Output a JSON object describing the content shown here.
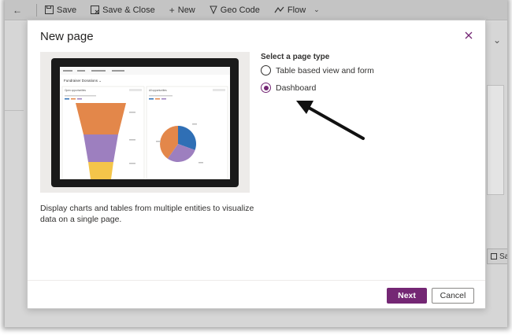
{
  "background_app": {
    "toolbar": {
      "back_glyph": "←",
      "save_label": "Save",
      "save_close_label": "Save & Close",
      "new_label": "New",
      "geo_code_label": "Geo Code",
      "flow_label": "Flow"
    },
    "side_button_label": "Sa"
  },
  "dialog": {
    "title": "New page",
    "close_icon": "close-icon",
    "description": "Display charts and tables from multiple entities to visualize data on a single page.",
    "section_label": "Select a page type",
    "options": [
      {
        "label": "Table based view and form",
        "selected": false
      },
      {
        "label": "Dashboard",
        "selected": true
      }
    ],
    "next_label": "Next",
    "cancel_label": "Cancel"
  },
  "preview": {
    "dashboard_title": "Fundraiser Donations ⌄",
    "left_panel_title": "Open opportunities",
    "right_panel_title": "All opportunities"
  },
  "colors": {
    "accent": "#742774",
    "funnel_orange": "#e3874a",
    "funnel_purple": "#9d7fbf",
    "funnel_yellow": "#f4c54a",
    "pie_blue": "#2f6fb5"
  }
}
